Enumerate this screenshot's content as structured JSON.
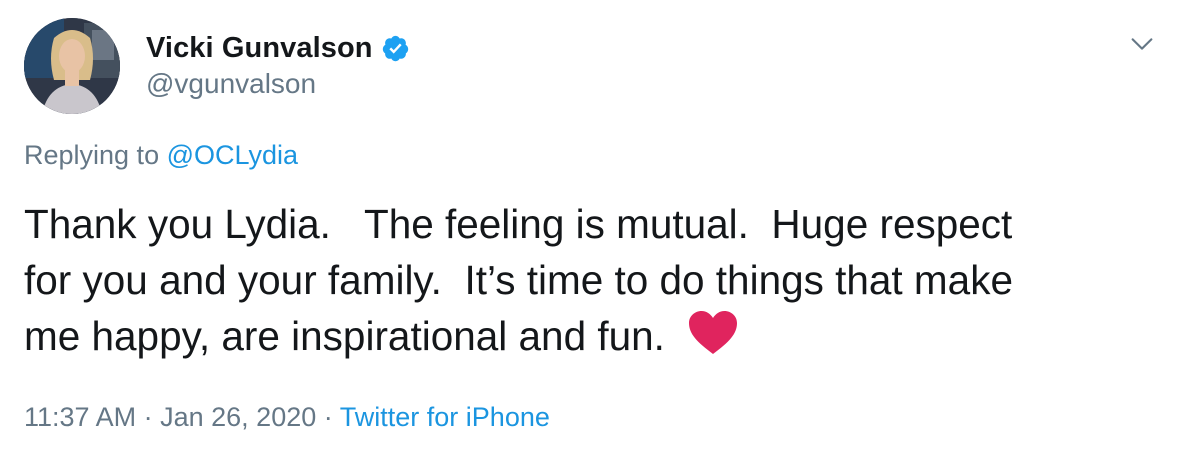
{
  "tweet": {
    "author": {
      "display_name": "Vicki Gunvalson",
      "handle": "@vgunvalson",
      "verified": true,
      "avatar_icon": "profile-photo"
    },
    "replying_to_prefix": "Replying to",
    "replying_to_handle": "@OCLydia",
    "text_line1": "Thank you Lydia.   The feeling is mutual.  Huge respect",
    "text_line2": "for you and your family.  It’s time to do things that make",
    "text_line3": "me happy, are inspirational and fun.",
    "emoji": "heart-icon",
    "time": "11:37 AM",
    "separator": "·",
    "date": "Jan 26, 2020",
    "source": "Twitter for iPhone"
  },
  "colors": {
    "text_primary": "#14171a",
    "text_secondary": "#657786",
    "link": "#1b95e0",
    "verified_badge": "#1da1f2",
    "heart": "#e0245e"
  }
}
